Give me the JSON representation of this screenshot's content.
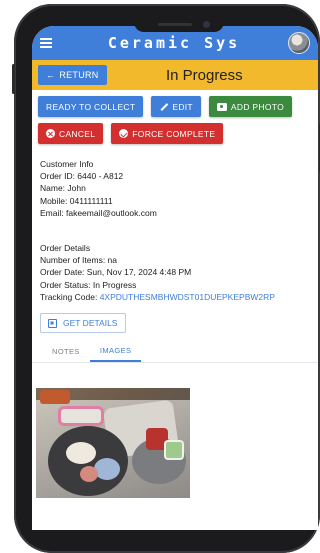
{
  "app": {
    "title": "Ceramic Sys",
    "menu_icon": "hamburger-menu-icon",
    "avatar_icon": "user-avatar"
  },
  "banner": {
    "return_label": "RETURN",
    "status": "In Progress",
    "color": "#f2b92d"
  },
  "actions": {
    "ready_to_collect": "READY TO COLLECT",
    "edit": "EDIT",
    "add_photo": "ADD PHOTO",
    "cancel": "CANCEL",
    "force_complete": "FORCE COMPLETE"
  },
  "customer": {
    "heading": "Customer Info",
    "order_id": "Order ID: 6440 - A812",
    "name": "Name: John",
    "mobile": "Mobile: 0411111111",
    "email": "Email: fakeemail@outlook.com"
  },
  "order": {
    "heading": "Order Details",
    "items": "Number of Items: na",
    "date": "Order Date: Sun, Nov 17, 2024 4:48 PM",
    "status": "Order Status: In Progress",
    "tracking_label": "Tracking Code: ",
    "tracking_code": "4XPDUTHESMBHWDST01DUEPKEPBW2RP"
  },
  "get_details": "GET DETAILS",
  "tabs": [
    {
      "label": "NOTES"
    },
    {
      "label": "IMAGES",
      "active": true
    }
  ],
  "colors": {
    "primary": "#3f7fd9",
    "success": "#3b8a3e",
    "danger": "#d32f2f"
  }
}
